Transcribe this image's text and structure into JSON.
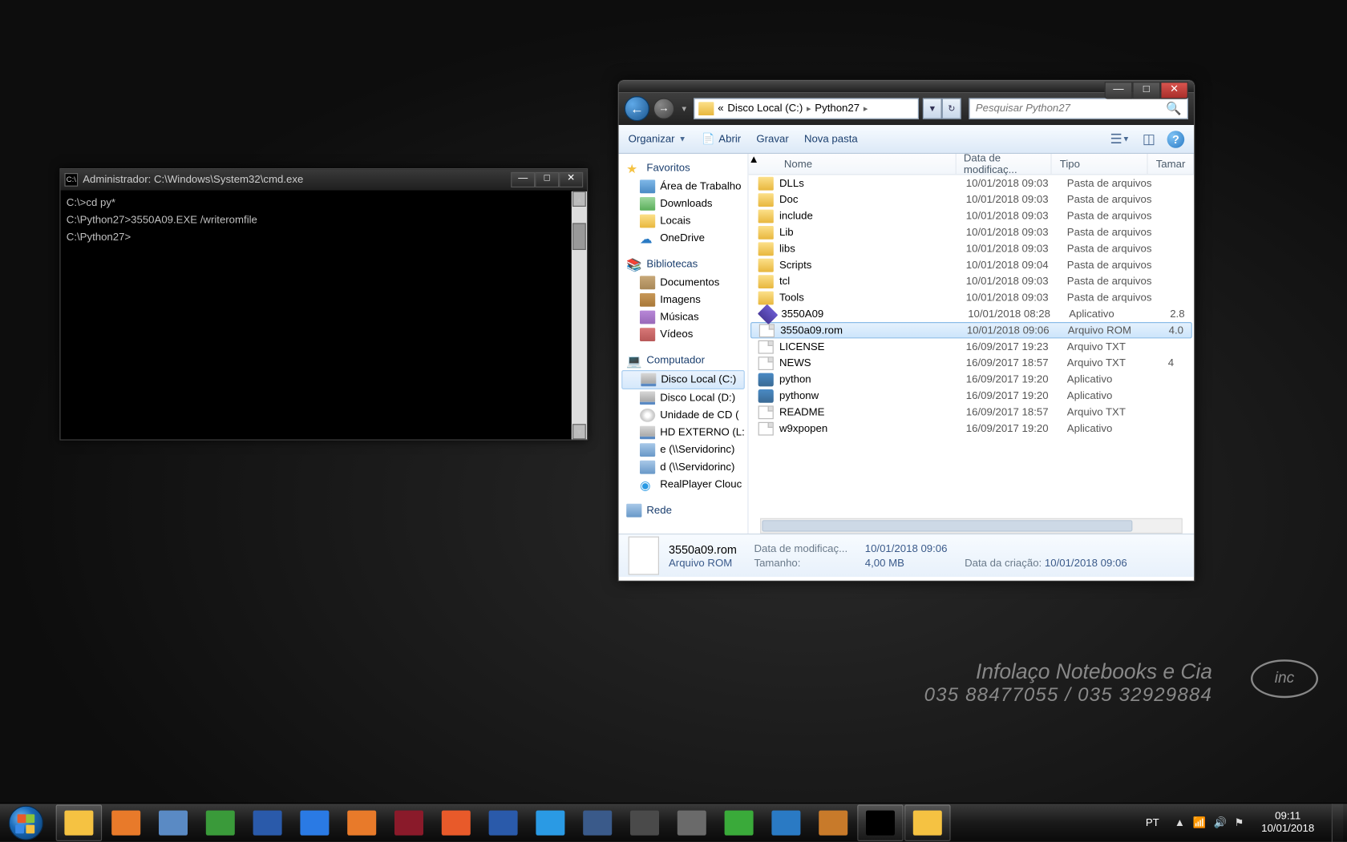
{
  "cmd": {
    "title": "Administrador: C:\\Windows\\System32\\cmd.exe",
    "lines": [
      "C:\\>cd py*",
      "",
      "C:\\Python27>3550A09.EXE /writeromfile",
      "",
      "C:\\Python27>"
    ]
  },
  "explorer": {
    "breadcrumb": {
      "prefix": "«",
      "p1": "Disco Local (C:)",
      "p2": "Python27"
    },
    "search_placeholder": "Pesquisar Python27",
    "toolbar": {
      "organize": "Organizar",
      "open": "Abrir",
      "burn": "Gravar",
      "newfolder": "Nova pasta"
    },
    "columns": {
      "name": "Nome",
      "date": "Data de modificaç...",
      "type": "Tipo",
      "size": "Tamar"
    },
    "sidebar": {
      "favorites": "Favoritos",
      "fav_items": [
        "Área de Trabalho",
        "Downloads",
        "Locais",
        "OneDrive"
      ],
      "libraries": "Bibliotecas",
      "lib_items": [
        "Documentos",
        "Imagens",
        "Músicas",
        "Vídeos"
      ],
      "computer": "Computador",
      "comp_items": [
        "Disco Local (C:)",
        "Disco Local (D:)",
        "Unidade de CD (",
        "HD EXTERNO (L:",
        "e (\\\\Servidorinc)",
        "d (\\\\Servidorinc)",
        "RealPlayer Clouc"
      ],
      "network": "Rede"
    },
    "files": [
      {
        "n": "DLLs",
        "d": "10/01/2018 09:03",
        "t": "Pasta de arquivos",
        "s": "",
        "k": "folder"
      },
      {
        "n": "Doc",
        "d": "10/01/2018 09:03",
        "t": "Pasta de arquivos",
        "s": "",
        "k": "folder"
      },
      {
        "n": "include",
        "d": "10/01/2018 09:03",
        "t": "Pasta de arquivos",
        "s": "",
        "k": "folder"
      },
      {
        "n": "Lib",
        "d": "10/01/2018 09:03",
        "t": "Pasta de arquivos",
        "s": "",
        "k": "folder"
      },
      {
        "n": "libs",
        "d": "10/01/2018 09:03",
        "t": "Pasta de arquivos",
        "s": "",
        "k": "folder"
      },
      {
        "n": "Scripts",
        "d": "10/01/2018 09:04",
        "t": "Pasta de arquivos",
        "s": "",
        "k": "folder"
      },
      {
        "n": "tcl",
        "d": "10/01/2018 09:03",
        "t": "Pasta de arquivos",
        "s": "",
        "k": "folder"
      },
      {
        "n": "Tools",
        "d": "10/01/2018 09:03",
        "t": "Pasta de arquivos",
        "s": "",
        "k": "folder"
      },
      {
        "n": "3550A09",
        "d": "10/01/2018 08:28",
        "t": "Aplicativo",
        "s": "2.8",
        "k": "exe"
      },
      {
        "n": "3550a09.rom",
        "d": "10/01/2018 09:06",
        "t": "Arquivo ROM",
        "s": "4.0",
        "k": "file",
        "sel": true
      },
      {
        "n": "LICENSE",
        "d": "16/09/2017 19:23",
        "t": "Arquivo TXT",
        "s": "",
        "k": "file"
      },
      {
        "n": "NEWS",
        "d": "16/09/2017 18:57",
        "t": "Arquivo TXT",
        "s": "4",
        "k": "file"
      },
      {
        "n": "python",
        "d": "16/09/2017 19:20",
        "t": "Aplicativo",
        "s": "",
        "k": "py"
      },
      {
        "n": "pythonw",
        "d": "16/09/2017 19:20",
        "t": "Aplicativo",
        "s": "",
        "k": "py"
      },
      {
        "n": "README",
        "d": "16/09/2017 18:57",
        "t": "Arquivo TXT",
        "s": "",
        "k": "file"
      },
      {
        "n": "w9xpopen",
        "d": "16/09/2017 19:20",
        "t": "Aplicativo",
        "s": "",
        "k": "file"
      }
    ],
    "details": {
      "name": "3550a09.rom",
      "type": "Arquivo ROM",
      "modlabel": "Data de modificaç...",
      "modval": "10/01/2018 09:06",
      "createdlabel": "Data da criação:",
      "createdval": "10/01/2018 09:06",
      "sizelabel": "Tamanho:",
      "sizeval": "4,00 MB"
    }
  },
  "watermark": {
    "l1": "Infolaço Notebooks e Cia",
    "l2": "035 88477055 / 035 32929884",
    "logo": "inc"
  },
  "taskbar": {
    "lang": "PT",
    "time": "09:11",
    "date": "10/01/2018",
    "apps": [
      {
        "c": "#f5c242",
        "active": true
      },
      {
        "c": "#e87a2a"
      },
      {
        "c": "#5a8ac4"
      },
      {
        "c": "#3a9a3a"
      },
      {
        "c": "#2a5aaa"
      },
      {
        "c": "#2a7ae4"
      },
      {
        "c": "#e87a2a"
      },
      {
        "c": "#8a1a2a"
      },
      {
        "c": "#e85a2a"
      },
      {
        "c": "#2a5aaa"
      },
      {
        "c": "#2a9ae4"
      },
      {
        "c": "#3a5a8a"
      },
      {
        "c": "#4a4a4a"
      },
      {
        "c": "#6a6a6a"
      },
      {
        "c": "#3aaa3a"
      },
      {
        "c": "#2a7ac4"
      },
      {
        "c": "#c87a2a"
      },
      {
        "c": "#000000",
        "active": true
      },
      {
        "c": "#f5c242",
        "active": true
      }
    ]
  }
}
